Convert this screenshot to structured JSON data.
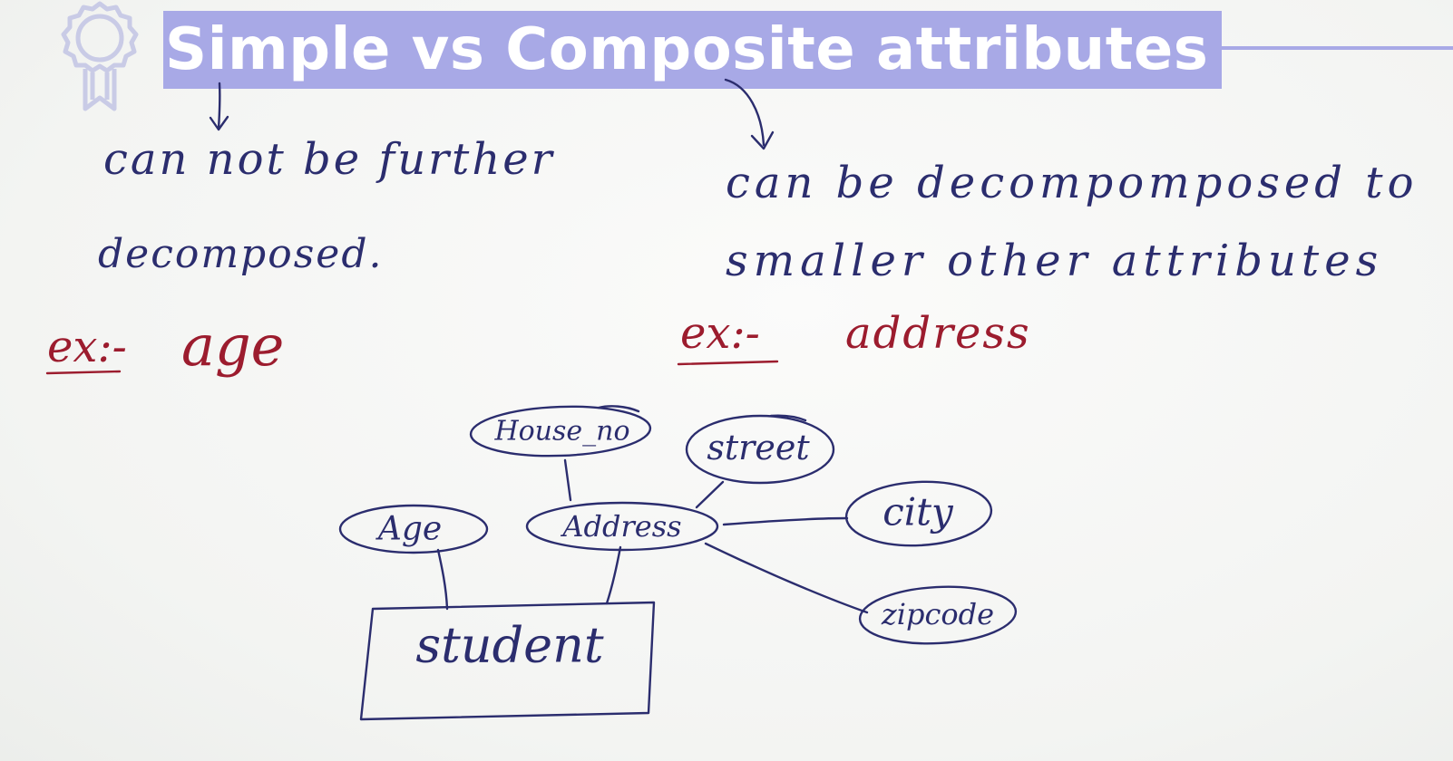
{
  "title": "Simple vs Composite attributes",
  "colors": {
    "title_band": "#a8a9e6",
    "ink": "#2b2d6e",
    "example_ink": "#9c1c2e"
  },
  "icons": {
    "badge": "award-ribbon-icon"
  },
  "simple": {
    "definition_line1": "can not be further",
    "definition_line2": "decomposed.",
    "example_prefix": "ex:-",
    "example_value": "age"
  },
  "composite": {
    "definition_line1": "can be decompomposed to",
    "definition_line2": "smaller other attributes",
    "example_prefix": "ex:-",
    "example_value": "address"
  },
  "er_diagram": {
    "entity": "student",
    "attributes": {
      "age": "Age",
      "address": "Address",
      "house_no": "House_no",
      "street": "street",
      "city": "city",
      "zipcode": "zipcode"
    }
  }
}
